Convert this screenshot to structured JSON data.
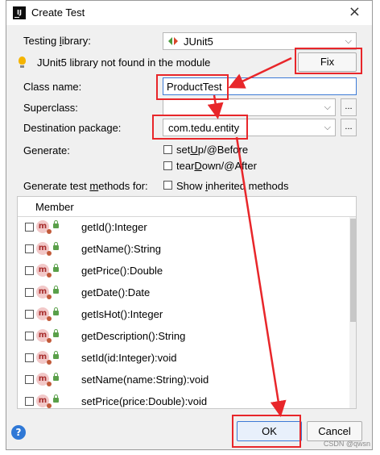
{
  "window": {
    "title": "Create Test",
    "app_icon": "intellij-icon"
  },
  "testing_library": {
    "label": "Testing library:",
    "value": "JUnit5"
  },
  "warning": {
    "text": "JUnit5 library not found in the module",
    "fix_label": "Fix"
  },
  "class_name": {
    "label": "Class name:",
    "value": "ProductTest"
  },
  "superclass": {
    "label": "Superclass:",
    "value": ""
  },
  "destination": {
    "label": "Destination package:",
    "value": "com.tedu.entity"
  },
  "generate": {
    "label": "Generate:",
    "setup": {
      "prefix": "set",
      "mnemonic": "U",
      "suffix": "p/@Before",
      "checked": false
    },
    "teardown": {
      "prefix": "tear",
      "mnemonic": "D",
      "suffix": "own/@After",
      "checked": false
    }
  },
  "methods_for": {
    "prefix": "Generate test ",
    "mnemonic": "m",
    "suffix": "ethods for:",
    "show_inherited": {
      "prefix": "Show ",
      "mnemonic": "i",
      "suffix": "nherited methods",
      "checked": false
    }
  },
  "table": {
    "header": "Member",
    "rows": [
      "getId():Integer",
      "getName():String",
      "getPrice():Double",
      "getDate():Date",
      "getIsHot():Integer",
      "getDescription():String",
      "setId(id:Integer):void",
      "setName(name:String):void",
      "setPrice(price:Double):void"
    ]
  },
  "buttons": {
    "ok": "OK",
    "cancel": "Cancel",
    "dots": "..."
  },
  "watermark": "CSDN @qwsn",
  "colors": {
    "accent": "#3d7ad6",
    "annotation_red": "#e8262a"
  }
}
